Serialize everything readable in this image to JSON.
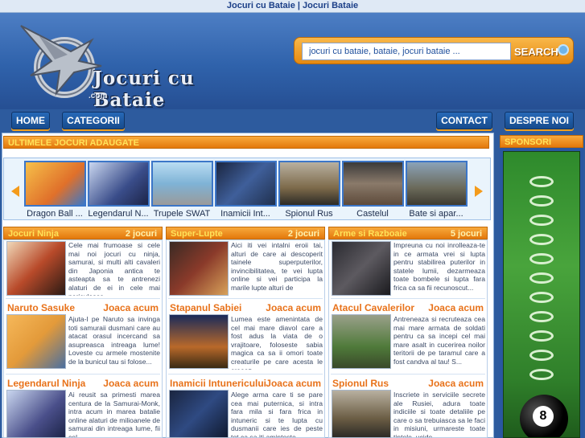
{
  "page_title": {
    "left": "Jocuri cu Bataie",
    "separator": "|",
    "right": "Jocuri Bataie"
  },
  "logo": {
    "text": "Jocuri cu Bataie",
    "suffix": ".com"
  },
  "search": {
    "value": "jocuri cu bataie, bataie, jocuri bataie ...",
    "button_label": "SEARCH"
  },
  "nav": {
    "home": "HOME",
    "categorii": "CATEGORII",
    "contact": "CONTACT",
    "despre": "DESPRE NOI"
  },
  "latest": {
    "title": "ULTIMELE JOCURI ADAUGATE",
    "items": [
      {
        "label": "Dragon Ball ...",
        "color": "#f0a030"
      },
      {
        "label": "Legendarul N...",
        "color": "#3a4d8a"
      },
      {
        "label": "Trupele SWAT",
        "color": "#7fb3d6"
      },
      {
        "label": "Inamicii Int...",
        "color": "#2c3f6a"
      },
      {
        "label": "Spionul Rus",
        "color": "#7d6a4a"
      },
      {
        "label": "Castelul",
        "color": "#5d4a3a"
      },
      {
        "label": "Bate si apar...",
        "color": "#6b6a5a"
      }
    ]
  },
  "columns": [
    {
      "category": "Jocuri Ninja",
      "count": "2 jocuri",
      "intro": "Cele mai frumoase si cele mai noi jocuri cu ninja, samurai, si multi alti cavaleri din Japonia antica te asteapta sa te antrenezi alaturi de ei in cele mai periculoase",
      "games": [
        {
          "title": "Naruto Sasuke",
          "action": "Joaca acum",
          "desc": "Ajuta-l pe Naruto sa invinga toti samuraii dusmani care au atacat orasul incercand sa asupreasca intreaga lume! Loveste cu armele mostenite de la bunicul tau si folose...",
          "color": "#e39a3a"
        },
        {
          "title": "Legendarul Ninja",
          "action": "Joaca acum",
          "desc": "Ai reusit sa primesti marea centura de la Samurai-Monk, intra acum in marea batalie online alaturi de milioanele de samurai din intreaga lume, fii cel",
          "color": "#4a4f8a"
        }
      ]
    },
    {
      "category": "Super-Lupte",
      "count": "2 jocuri",
      "intro": "Aici iti vei intalni eroii tai, alturi de care ai descoperit tainele superputerilor, invincibilitatea, te vei lupta online si vei participa la marile lupte alturi de",
      "games": [
        {
          "title": "Stapanul Sabiei",
          "action": "Joaca acum",
          "desc": "Lumea este amenintata de cel mai mare diavol care a fost adus la viata de o vrajitoare, foloseste sabia magica ca sa ii omori toate creaturile pe care acesta le creeaz...",
          "color": "#b9692a"
        },
        {
          "title": "Inamicii Intunericului",
          "action": "Joaca acum",
          "desc": "Alege arma care ti se pare cea mai puternica, si intra fara mila si fara frica in intuneric si te lupta cu dusmanii care ies de peste tot ca sa iti aminteste",
          "color": "#2f4a82"
        }
      ]
    },
    {
      "category": "Arme si Razboaie",
      "count": "5 jocuri",
      "intro": "Impreuna cu noi inrolleaza-te in ce armata vrei si lupta pentru stabilirea puterilor in statele lumii, dezarmeaza toate bombele si lupta fara frica ca sa fii recunoscut...",
      "games": [
        {
          "title": "Atacul Cavalerilor",
          "action": "Joaca acum",
          "desc": "Antreneaza si recruteaza cea mai mare armata de soldati pentru ca sa incepi cel mai mare asalt in cucerirea noilor teritorii de pe taramul care a fost candva al tau! S...",
          "color": "#4f7a3a"
        },
        {
          "title": "Spionul Rus",
          "action": "Joaca acum",
          "desc": "Inscriete in serviciile secrete ale Rusiei, adura toate indiciile si toate detaliile pe care o sa trebuiasca sa le faci in misiuni, urmareste toate tintele, ucide",
          "color": "#6b5d44"
        }
      ]
    }
  ],
  "sponsor": {
    "title": "SPONSORI",
    "ball_number": "8"
  }
}
